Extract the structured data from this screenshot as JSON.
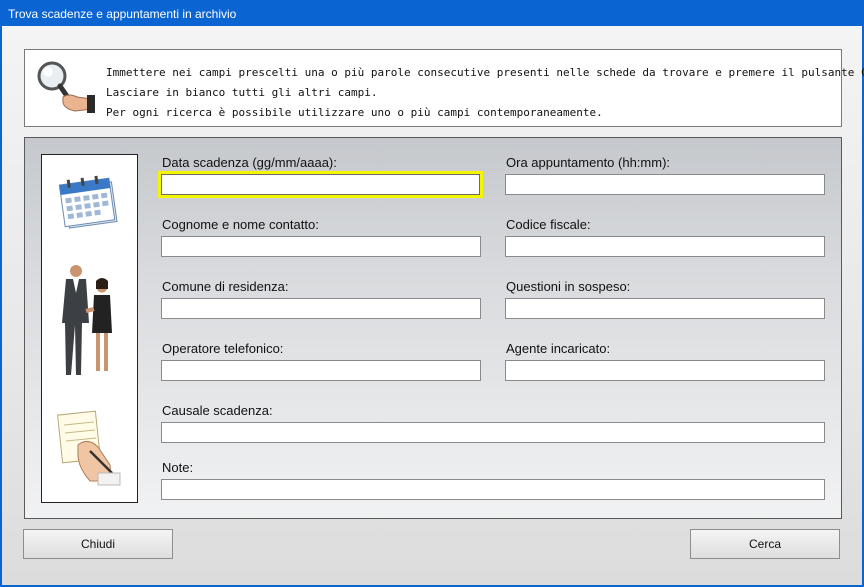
{
  "window": {
    "title": "Trova scadenze e appuntamenti in archivio"
  },
  "info": {
    "lines": [
      "Immettere nei campi prescelti una o più parole consecutive presenti nelle schede da trovare e premere il pulsante Cerca.",
      "Lasciare in bianco tutti gli altri campi.",
      "Per ogni ricerca è possibile utilizzare uno o più campi contemporaneamente."
    ]
  },
  "fields": {
    "data_scadenza": {
      "label": "Data scadenza (gg/mm/aaaa):",
      "value": ""
    },
    "ora_appuntamento": {
      "label": "Ora appuntamento (hh:mm):",
      "value": ""
    },
    "cognome_nome": {
      "label": "Cognome e nome contatto:",
      "value": ""
    },
    "codice_fiscale": {
      "label": "Codice fiscale:",
      "value": ""
    },
    "comune": {
      "label": "Comune di residenza:",
      "value": ""
    },
    "questioni": {
      "label": "Questioni in sospeso:",
      "value": ""
    },
    "operatore": {
      "label": "Operatore telefonico:",
      "value": ""
    },
    "agente": {
      "label": "Agente incaricato:",
      "value": ""
    },
    "causale": {
      "label": "Causale scadenza:",
      "value": ""
    },
    "note": {
      "label": "Note:",
      "value": ""
    }
  },
  "buttons": {
    "close_label": "Chiudi",
    "search_label": "Cerca"
  },
  "colors": {
    "titlebar": "#0a64d2",
    "focus_highlight": "#f5f500"
  },
  "icons": [
    "magnifier-hand-icon",
    "calendar-icon",
    "business-people-icon",
    "writing-hand-icon"
  ]
}
